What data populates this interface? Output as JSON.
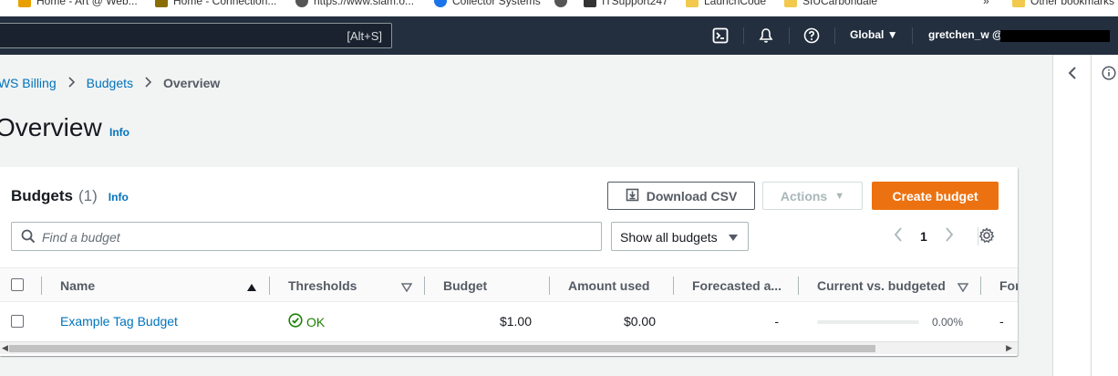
{
  "bookmarks": [
    {
      "label": "Home - Art @ Web...",
      "icon_color": "#e8a000"
    },
    {
      "label": "Home - Connection...",
      "icon_color": "#8a6d00"
    },
    {
      "label": "https://www.slam.o...",
      "icon_color": "#555555"
    },
    {
      "label": "Collector Systems",
      "icon_color": "#1a73e8"
    },
    {
      "label": "",
      "icon_color": "#555555"
    },
    {
      "label": "ITSupport247",
      "icon_color": "#333333"
    },
    {
      "label": "LaunchCode",
      "icon_color": "#f2c94c"
    },
    {
      "label": "SIUCarbondale",
      "icon_color": "#f2c94c"
    },
    {
      "label": "Other bookmarks",
      "icon_color": "#f2c94c"
    }
  ],
  "topnav": {
    "search_shortcut": "[Alt+S]",
    "region": "Global",
    "user": "gretchen_w @"
  },
  "breadcrumb": {
    "items": [
      "AWS Billing",
      "Budgets"
    ],
    "current": "Overview"
  },
  "page": {
    "title": "Overview",
    "info": "Info"
  },
  "budgets": {
    "title": "Budgets",
    "count": "(1)",
    "info": "Info",
    "download_label": "Download CSV",
    "actions_label": "Actions",
    "create_label": "Create budget",
    "search_placeholder": "Find a budget",
    "filter_value": "Show all budgets",
    "page_number": "1",
    "columns": [
      "Name",
      "Thresholds",
      "Budget",
      "Amount used",
      "Forecasted a...",
      "Current vs. budgeted",
      "For"
    ],
    "rows": [
      {
        "name": "Example Tag Budget",
        "threshold": "OK",
        "budget": "$1.00",
        "amount_used": "$0.00",
        "forecasted": "-",
        "current_vs_budgeted": "0.00%",
        "current_vs_budgeted_fraction": 0.0,
        "last": "-"
      }
    ]
  },
  "colors": {
    "nav_bg": "#232f3e",
    "primary_button": "#ec7211",
    "link": "#0073bb",
    "success": "#1d8102"
  }
}
